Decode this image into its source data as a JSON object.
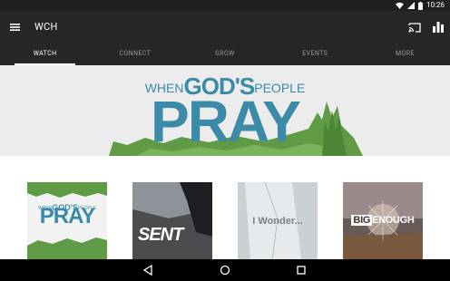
{
  "status_bar": {
    "time": "10:26",
    "icons": [
      "wifi-icon",
      "signal-icon",
      "battery-icon"
    ]
  },
  "app_bar": {
    "title": "WCH",
    "icons": [
      "menu-icon",
      "cast-icon",
      "bar-chart-icon"
    ]
  },
  "tabs": [
    {
      "label": "WATCH",
      "active": true
    },
    {
      "label": "CONNECT",
      "active": false
    },
    {
      "label": "GROW",
      "active": false
    },
    {
      "label": "EVENTS",
      "active": false
    },
    {
      "label": "MORE",
      "active": false
    }
  ],
  "hero": {
    "line1_when": "WHEN",
    "line1_gods": "GOD'S",
    "line1_people": "PEOPLE",
    "line2": "PRAY"
  },
  "cards": [
    {
      "when": "WHEN",
      "gods": "GOD'S",
      "people": "PEOPLE",
      "title": "PRAY"
    },
    {
      "title": "SENT"
    },
    {
      "title": "I Wonder..."
    },
    {
      "big": "BIG",
      "enough": "ENOUGH"
    }
  ],
  "nav_bar": {
    "icons": [
      "back-icon",
      "home-icon",
      "recent-apps-icon"
    ]
  },
  "colors": {
    "accent": "#3a8aa8",
    "app_bar": "#262626",
    "brush_green": "#5f9a45"
  }
}
